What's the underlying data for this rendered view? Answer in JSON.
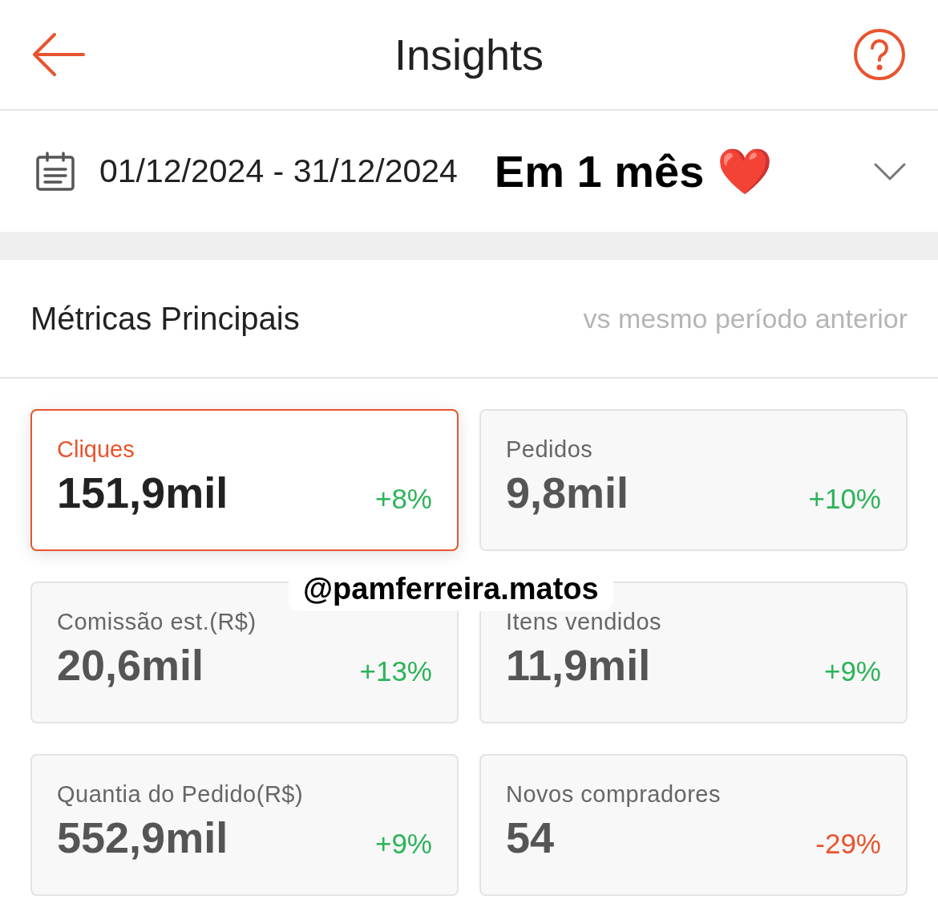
{
  "header": {
    "title": "Insights"
  },
  "date_range": {
    "value": "01/12/2024 - 31/12/2024"
  },
  "sticker_caption": "Em 1 mês ❤️",
  "metrics_section": {
    "title": "Métricas Principais",
    "comparison": "vs mesmo período anterior"
  },
  "metrics": [
    {
      "label": "Cliques",
      "value": "151,9mil",
      "change": "+8%",
      "color": "#2db35a",
      "selected": true
    },
    {
      "label": "Pedidos",
      "value": "9,8mil",
      "change": "+10%",
      "color": "#2db35a",
      "selected": false
    },
    {
      "label": "Comissão est.(R$)",
      "value": "20,6mil",
      "change": "+13%",
      "color": "#2db35a",
      "selected": false
    },
    {
      "label": "Itens vendidos",
      "value": "11,9mil",
      "change": "+9%",
      "color": "#2db35a",
      "selected": false
    },
    {
      "label": "Quantia do Pedido(R$)",
      "value": "552,9mil",
      "change": "+9%",
      "color": "#2db35a",
      "selected": false
    },
    {
      "label": "Novos compradores",
      "value": "54",
      "change": "-29%",
      "color": "#e8542e",
      "selected": false
    }
  ],
  "handle_sticker": "@pamferreira.matos"
}
